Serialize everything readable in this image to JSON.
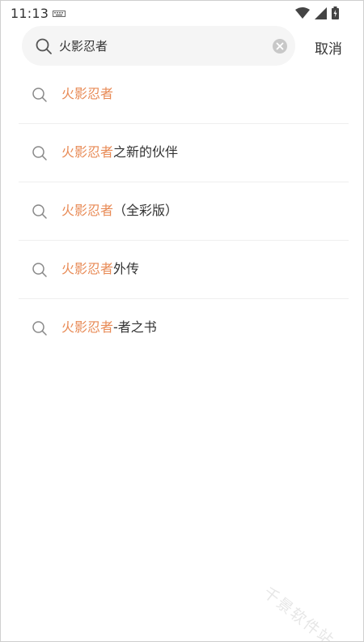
{
  "status_bar": {
    "time": "11:13"
  },
  "search": {
    "query": "火影忍者",
    "cancel_label": "取消"
  },
  "suggestions": [
    {
      "highlight": "火影忍者",
      "rest": ""
    },
    {
      "highlight": "火影忍者",
      "rest": "之新的伙伴"
    },
    {
      "highlight": "火影忍者",
      "rest": "（全彩版）"
    },
    {
      "highlight": "火影忍者",
      "rest": "外传"
    },
    {
      "highlight": "火影忍者",
      "rest": "-者之书"
    }
  ],
  "watermark": "千景软件站",
  "colors": {
    "highlight": "#e88a55",
    "text": "#333333",
    "search_bg": "#f5f5f5"
  },
  "icons": {
    "search": "search-icon",
    "clear": "clear-icon",
    "wifi": "wifi-icon",
    "signal": "signal-icon",
    "battery": "battery-icon",
    "keyboard": "keyboard-icon"
  }
}
